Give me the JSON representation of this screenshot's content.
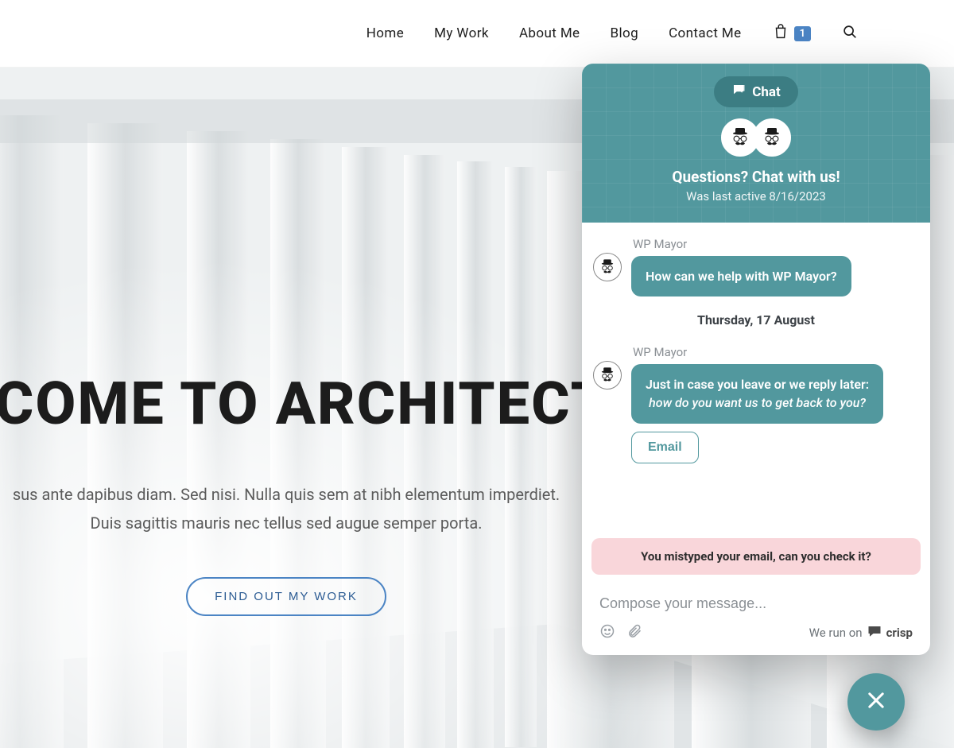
{
  "nav": {
    "items": [
      "Home",
      "My Work",
      "About Me",
      "Blog",
      "Contact Me"
    ],
    "cart_count": "1"
  },
  "hero": {
    "title": "LCOME TO ARCHITECT",
    "subtitle_line1": "sus ante dapibus diam. Sed nisi. Nulla quis sem at nibh elementum imperdiet.",
    "subtitle_line2": "Duis sagittis mauris nec tellus sed augue semper porta.",
    "cta": "FIND OUT MY WORK"
  },
  "chat": {
    "badge": "Chat",
    "title": "Questions? Chat with us!",
    "status": "Was last active 8/16/2023",
    "sender": "WP Mayor",
    "msg1": "How can we help with WP Mayor?",
    "date": "Thursday, 17 August",
    "msg2_line1": "Just in case you leave or we reply later:",
    "msg2_line2": "how do you want us to get back to you?",
    "email_btn": "Email",
    "error": "You mistyped your email, can you check it?",
    "compose_placeholder": "Compose your message...",
    "powered_prefix": "We run on",
    "powered_brand": "crisp"
  },
  "colors": {
    "accent_teal": "#52989e",
    "nav_blue": "#4b84c4",
    "error_bg": "#f9d6da"
  }
}
